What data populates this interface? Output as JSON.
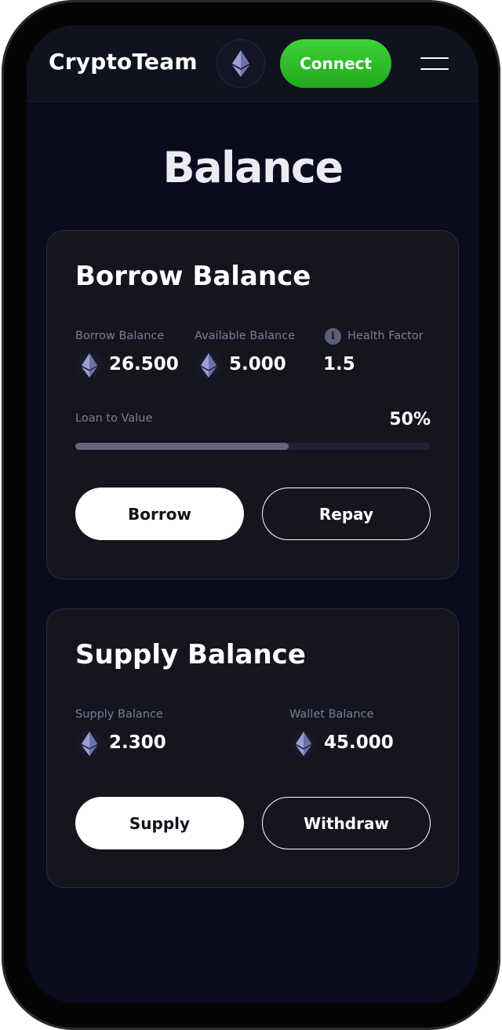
{
  "header": {
    "logo": "CryptoTeam",
    "network_icon": "ethereum-icon",
    "connect_label": "Connect",
    "menu_icon": "hamburger-menu-icon"
  },
  "page": {
    "title": "Balance"
  },
  "borrow_card": {
    "title": "Borrow Balance",
    "borrow_balance": {
      "label": "Borrow Balance",
      "value": "26.500",
      "icon": "ethereum-icon"
    },
    "available_balance": {
      "label": "Available Balance",
      "value": "5.000",
      "icon": "ethereum-icon"
    },
    "health_factor": {
      "label": "Health Factor",
      "value": "1.5",
      "icon": "info-icon"
    },
    "loan_to_value": {
      "label": "Loan to Value",
      "value": "50%",
      "fill_fraction": 0.6
    },
    "borrow_label": "Borrow",
    "repay_label": "Repay"
  },
  "supply_card": {
    "title": "Supply Balance",
    "supply_balance": {
      "label": "Supply Balance",
      "value": "2.300",
      "icon": "ethereum-icon"
    },
    "wallet_balance": {
      "label": "Wallet Balance",
      "value": "45.000",
      "icon": "ethereum-icon"
    },
    "supply_label": "Supply",
    "withdraw_label": "Withdraw"
  },
  "colors": {
    "background": "#0a0b1c",
    "card": "#14151f",
    "accent_green": "#2dbd27",
    "muted_text": "#7a7d96",
    "eth_icon": "#8a90c4"
  }
}
